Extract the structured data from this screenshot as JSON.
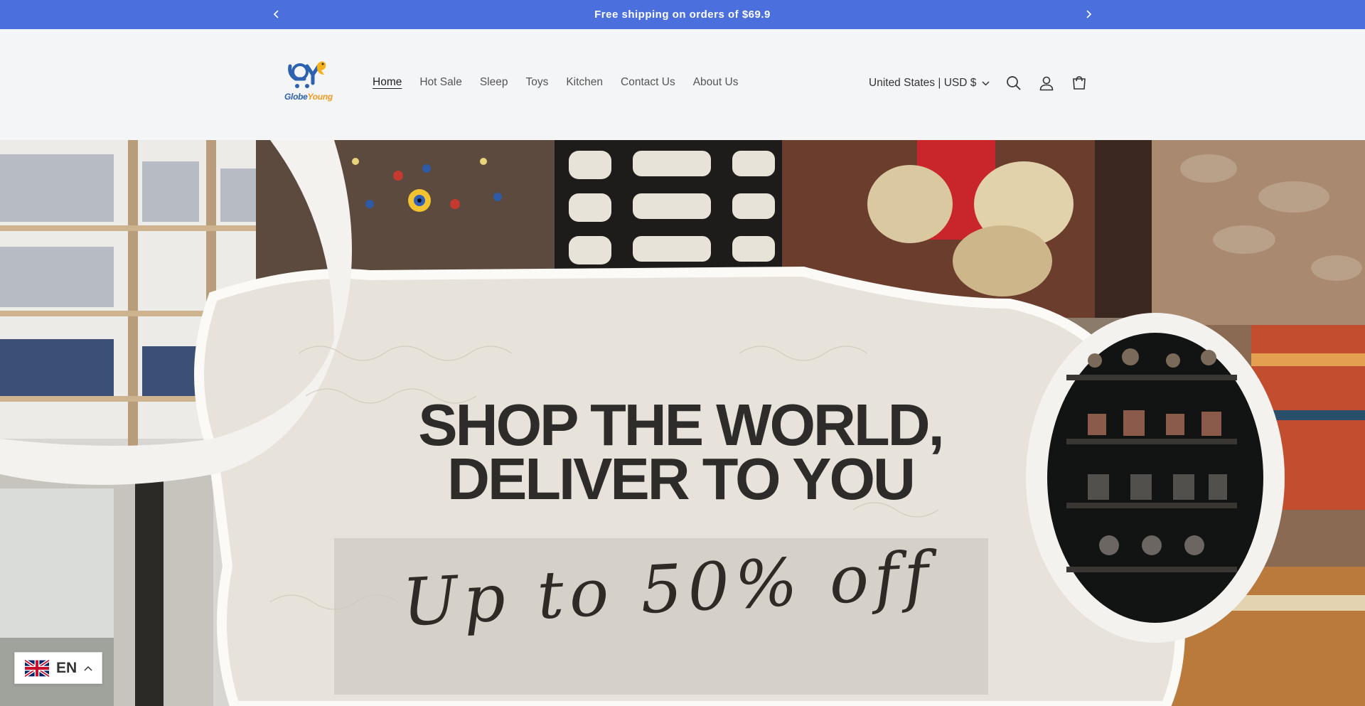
{
  "announcement": {
    "text": "Free shipping on orders of $69.9",
    "prev_icon": "chevron-left-icon",
    "next_icon": "chevron-right-icon"
  },
  "header": {
    "logo_text_part1": "Globe",
    "logo_text_part2": "Young",
    "nav": [
      "Home",
      "Hot Sale",
      "Sleep",
      "Toys",
      "Kitchen",
      "Contact Us",
      "About Us"
    ],
    "active_nav": "Home",
    "localization": "United States | USD $",
    "icons": [
      "search-icon",
      "account-icon",
      "cart-icon"
    ]
  },
  "hero": {
    "heading_line1": "SHOP THE WORLD,",
    "heading_line2": "DELIVER TO YOU",
    "subheading": "Up to 50% off"
  },
  "language": {
    "code": "EN",
    "flag": "uk-flag-icon"
  },
  "colors": {
    "announcement_bg": "#4b6fdc",
    "header_bg": "#f4f5f7",
    "text_dark": "#2e2c2a"
  }
}
